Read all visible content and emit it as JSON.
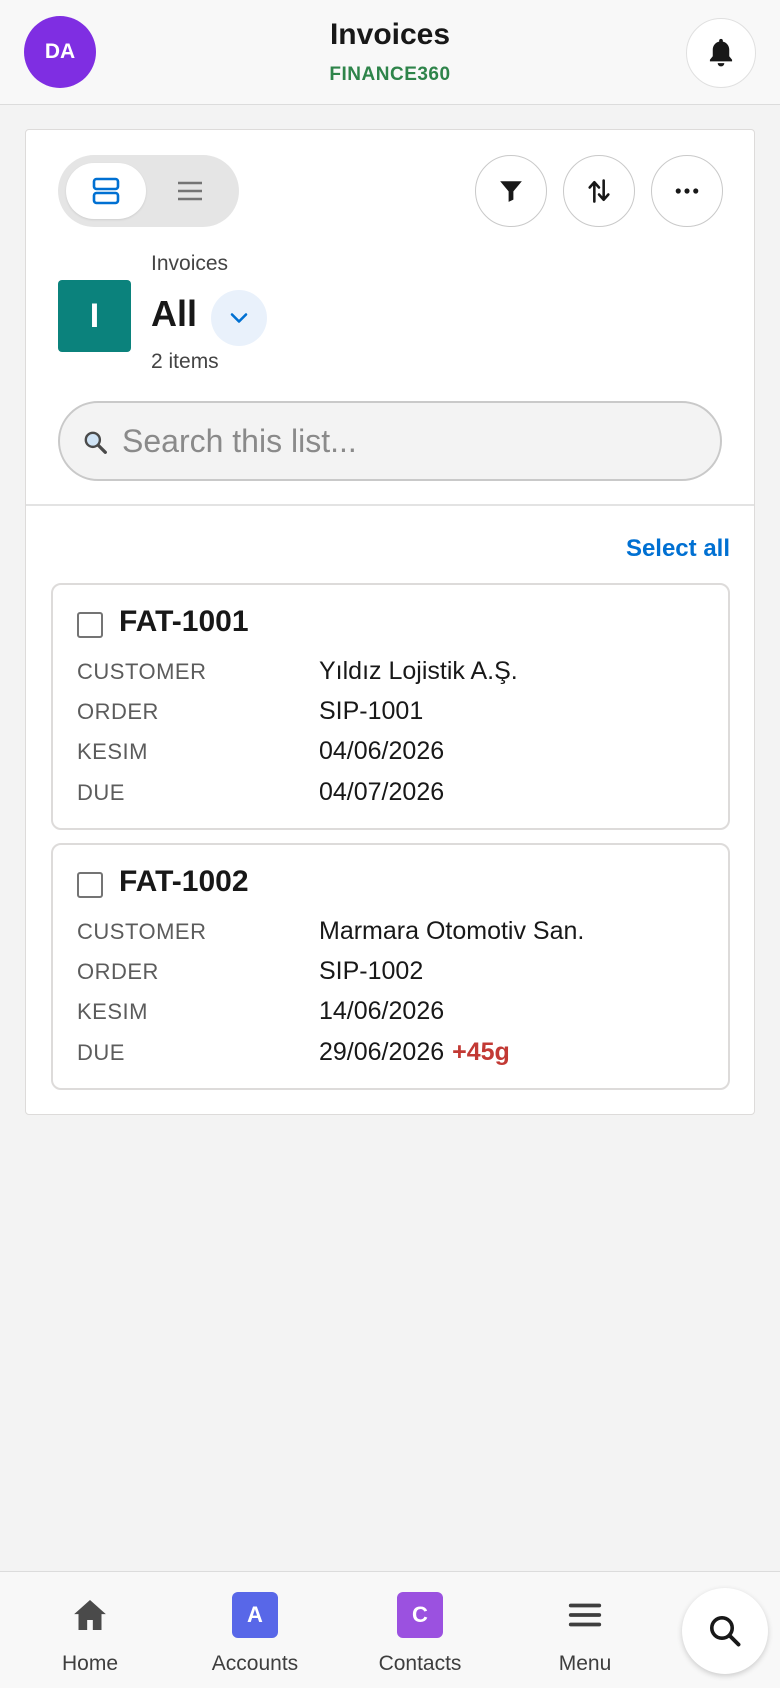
{
  "header": {
    "avatar_initials": "DA",
    "avatar_color": "#7f2ee2",
    "title": "Invoices",
    "subtitle": "FINANCE360",
    "subtitle_color": "#2e844a",
    "bell_icon": "bell-icon"
  },
  "toolbar": {
    "view_toggle": {
      "active": "card-view",
      "options": [
        "card-view-icon",
        "table-view-icon"
      ]
    },
    "filter_icon": "filter-icon",
    "sort_icon": "sort-icon",
    "more_icon": "more-icon"
  },
  "list_view": {
    "object_label": "Invoices",
    "icon_letter": "I",
    "icon_color": "#0b827c",
    "name": "All",
    "item_count": "2 items"
  },
  "search": {
    "placeholder": "Search this list...",
    "value": ""
  },
  "select_all_label": "Select all",
  "records": [
    {
      "title": "FAT-1001",
      "fields": [
        {
          "label": "CUSTOMER",
          "value": "Yıldız Lojistik A.Ş."
        },
        {
          "label": "ORDER",
          "value": "SIP-1001"
        },
        {
          "label": "KESIM",
          "value": "04/06/2026"
        },
        {
          "label": "DUE",
          "value": "04/07/2026",
          "badge": ""
        }
      ]
    },
    {
      "title": "FAT-1002",
      "fields": [
        {
          "label": "CUSTOMER",
          "value": "Marmara Otomotiv San."
        },
        {
          "label": "ORDER",
          "value": "SIP-1002"
        },
        {
          "label": "KESIM",
          "value": "14/06/2026"
        },
        {
          "label": "DUE",
          "value": "29/06/2026",
          "badge": "+45g"
        }
      ]
    }
  ],
  "tabbar": {
    "tabs": [
      {
        "label": "Home",
        "icon": "home-icon"
      },
      {
        "label": "Accounts",
        "icon_letter": "A",
        "icon_color": "#5867e8"
      },
      {
        "label": "Contacts",
        "icon_letter": "C",
        "icon_color": "#9b51e0"
      },
      {
        "label": "Menu",
        "icon": "menu-icon"
      }
    ],
    "search_icon": "search-icon"
  },
  "colors": {
    "accent_blue": "#0070d2",
    "overdue_red": "#c23934"
  }
}
